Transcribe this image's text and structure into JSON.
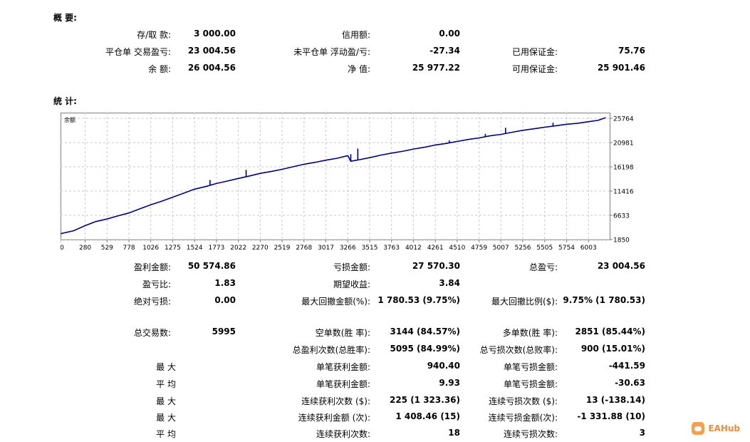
{
  "summary": {
    "title": "概 要:",
    "rows": [
      [
        {
          "label": "存/取 款:",
          "value": "3 000.00"
        },
        {
          "label": "信用额:",
          "value": "0.00"
        },
        null
      ],
      [
        {
          "label": "平仓单 交易盈亏:",
          "value": "23 004.56"
        },
        {
          "label": "未平仓单 浮动盈/亏:",
          "value": "-27.34"
        },
        {
          "label": "已用保证金:",
          "value": "75.76"
        }
      ],
      [
        {
          "label": "余 额:",
          "value": "26 004.56"
        },
        {
          "label": "净 值:",
          "value": "25 977.22"
        },
        {
          "label": "可用保证金:",
          "value": "25 901.46"
        }
      ]
    ]
  },
  "statistics": {
    "title": "统 计:",
    "rows": [
      [
        {
          "label": "盈利金额:",
          "value": "50 574.86"
        },
        {
          "label": "亏损金额:",
          "value": "27 570.30"
        },
        {
          "label": "总盈亏:",
          "value": "23 004.56"
        }
      ],
      [
        {
          "label": "盈亏比:",
          "value": "1.83"
        },
        {
          "label": "期望收益:",
          "value": "3.84"
        },
        null
      ],
      [
        {
          "label": "绝对亏损:",
          "value": "0.00"
        },
        {
          "label": "最大回撤金额(%):",
          "value": "1 780.53 (9.75%)"
        },
        {
          "label": "最大回撤比例($):",
          "value": "9.75% (1 780.53)"
        }
      ],
      [
        {
          "label": "总交易数:",
          "value": "5995"
        },
        {
          "label": "空单数(胜 率):",
          "value": "3144 (84.57%)"
        },
        {
          "label": "多单数(胜 率):",
          "value": "2851 (85.44%)"
        }
      ],
      [
        null,
        {
          "label": "总盈利次数(总胜率):",
          "value": "5095 (84.99%)"
        },
        {
          "label": "总亏损次数(总败率):",
          "value": "900 (15.01%)"
        }
      ],
      [
        {
          "label": "最 大",
          "value": ""
        },
        {
          "label": "单笔获利金额:",
          "value": "940.40"
        },
        {
          "label": "单笔亏损金额:",
          "value": "-441.59"
        }
      ],
      [
        {
          "label": "平 均",
          "value": ""
        },
        {
          "label": "单笔获利金额:",
          "value": "9.93"
        },
        {
          "label": "单笔亏损金额:",
          "value": "-30.63"
        }
      ],
      [
        {
          "label": "最 大",
          "value": ""
        },
        {
          "label": "连续获利次数 ($):",
          "value": "225 (1 323.36)"
        },
        {
          "label": "连续亏损次数 ($):",
          "value": "13 (-138.14)"
        }
      ],
      [
        {
          "label": "最 大",
          "value": ""
        },
        {
          "label": "连续获利金额 (次):",
          "value": "1 408.46 (15)"
        },
        {
          "label": "连续亏损金额(次):",
          "value": "-1 331.88 (10)"
        }
      ],
      [
        {
          "label": "平 均",
          "value": ""
        },
        {
          "label": "连续获利次数:",
          "value": "18"
        },
        {
          "label": "连续亏损次数:",
          "value": "3"
        }
      ]
    ]
  },
  "chart_data": {
    "type": "line",
    "title": "余额",
    "xlabel": "",
    "ylabel": "",
    "x_ticks": [
      0,
      280,
      529,
      778,
      1026,
      1275,
      1524,
      1773,
      2022,
      2270,
      2519,
      2768,
      3017,
      3266,
      3515,
      3763,
      4012,
      4261,
      4510,
      4759,
      5007,
      5256,
      5505,
      5754,
      6003
    ],
    "y_ticks": [
      1850,
      6633,
      11416,
      16198,
      20981,
      25764
    ],
    "xlim": [
      0,
      6244
    ],
    "ylim": [
      1850,
      25764
    ],
    "grid": true,
    "line_color": "#000080",
    "series": [
      {
        "values_x": [
          0,
          150,
          280,
          400,
          529,
          650,
          778,
          900,
          1026,
          1150,
          1275,
          1400,
          1524,
          1650,
          1773,
          1900,
          2022,
          2150,
          2270,
          2400,
          2519,
          2640,
          2768,
          2900,
          3017,
          3150,
          3266,
          3300,
          3400,
          3515,
          3640,
          3763,
          3900,
          4012,
          4150,
          4261,
          4380,
          4510,
          4640,
          4759,
          4880,
          5007,
          5130,
          5256,
          5380,
          5505,
          5630,
          5754,
          5880,
          6003,
          6110,
          6200
        ],
        "values_y": [
          3000,
          3600,
          4600,
          5400,
          5900,
          6500,
          7100,
          7900,
          8700,
          9400,
          10200,
          11000,
          11800,
          12300,
          12900,
          13400,
          13900,
          14400,
          14900,
          15300,
          15700,
          16200,
          16700,
          17100,
          17500,
          17900,
          18400,
          17300,
          17600,
          18000,
          18500,
          18900,
          19300,
          19700,
          20100,
          20500,
          20800,
          21200,
          21600,
          21900,
          22300,
          22600,
          23000,
          23400,
          23700,
          24000,
          24300,
          24600,
          24800,
          25100,
          25350,
          25900
        ],
        "spikes": [
          {
            "x": 1700,
            "y": 13600
          },
          {
            "x": 2110,
            "y": 15600
          },
          {
            "x": 3300,
            "y": 18700
          },
          {
            "x": 3380,
            "y": 19800
          },
          {
            "x": 4420,
            "y": 21400
          },
          {
            "x": 4830,
            "y": 22700
          },
          {
            "x": 5060,
            "y": 23900
          },
          {
            "x": 5600,
            "y": 24900
          }
        ]
      }
    ]
  },
  "watermark": {
    "text": "EAHub",
    "color": "#f08a3c"
  }
}
